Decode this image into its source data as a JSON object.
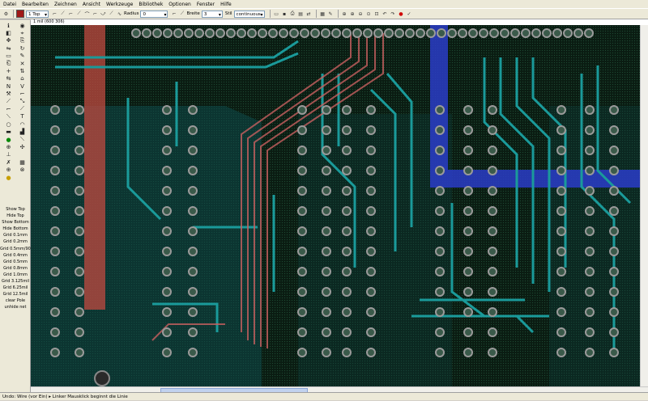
{
  "menu": [
    "Datei",
    "Bearbeiten",
    "Zeichnen",
    "Ansicht",
    "Werkzeuge",
    "Bibliothek",
    "Optionen",
    "Fenster",
    "Hilfe"
  ],
  "toolbar": {
    "layer_value": "1 Top",
    "radius_label": "Radius",
    "radius_value": "0",
    "width_label": "Breite",
    "width_value": "3",
    "style_label": "Stil",
    "style_value": "continuous"
  },
  "coord_readout": "1 mil (600 306)",
  "commands": [
    "Show Top",
    "Hide Top",
    "Show Bottom",
    "Hide Bottom",
    "Grid 0.1mm",
    "Grid 0.2mm",
    "Grid 0.5mm/90°",
    "Grid 0.4mm",
    "Grid 0.5mm",
    "Grid 0.8mm",
    "Grid 1.0mm",
    "Grid 3.125mil",
    "Grid 6.25mil",
    "Grid 12.5mil",
    "clear Pole",
    "unhide net"
  ],
  "status": "Undo: Wire (vor Ein) ▸ Linker Mausklick beginnt die Linie",
  "colors": {
    "top_layer": "#a01818",
    "bottom_layer": "#1a8a8a",
    "board_bg": "#0b1f14",
    "route_blue": "#2a3cc8"
  }
}
